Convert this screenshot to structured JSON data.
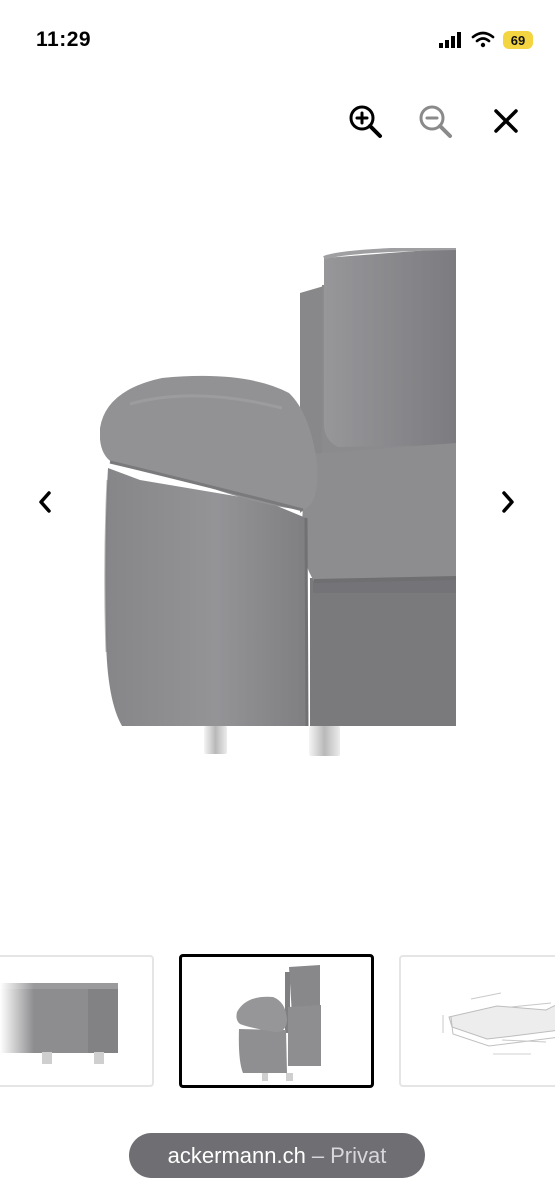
{
  "status_bar": {
    "time": "11:29",
    "battery": "69",
    "battery_color": "#f3d441"
  },
  "toolbar": {
    "zoom_in_icon": "zoom-in-icon",
    "zoom_out_icon": "zoom-out-icon",
    "close_icon": "close-icon"
  },
  "gallery": {
    "prev_icon": "chevron-left-icon",
    "next_icon": "chevron-right-icon",
    "selected_thumbnail_index": 1,
    "main_image_alt": "Grey fabric sofa side view"
  },
  "footer": {
    "site": "ackermann.ch",
    "separator": "–",
    "mode": "Privat"
  },
  "colors": {
    "sofa": "#8f8f92",
    "sofa_dark": "#7e7e82",
    "leg": "#cfcfcf",
    "pill": "#6e6e73"
  }
}
